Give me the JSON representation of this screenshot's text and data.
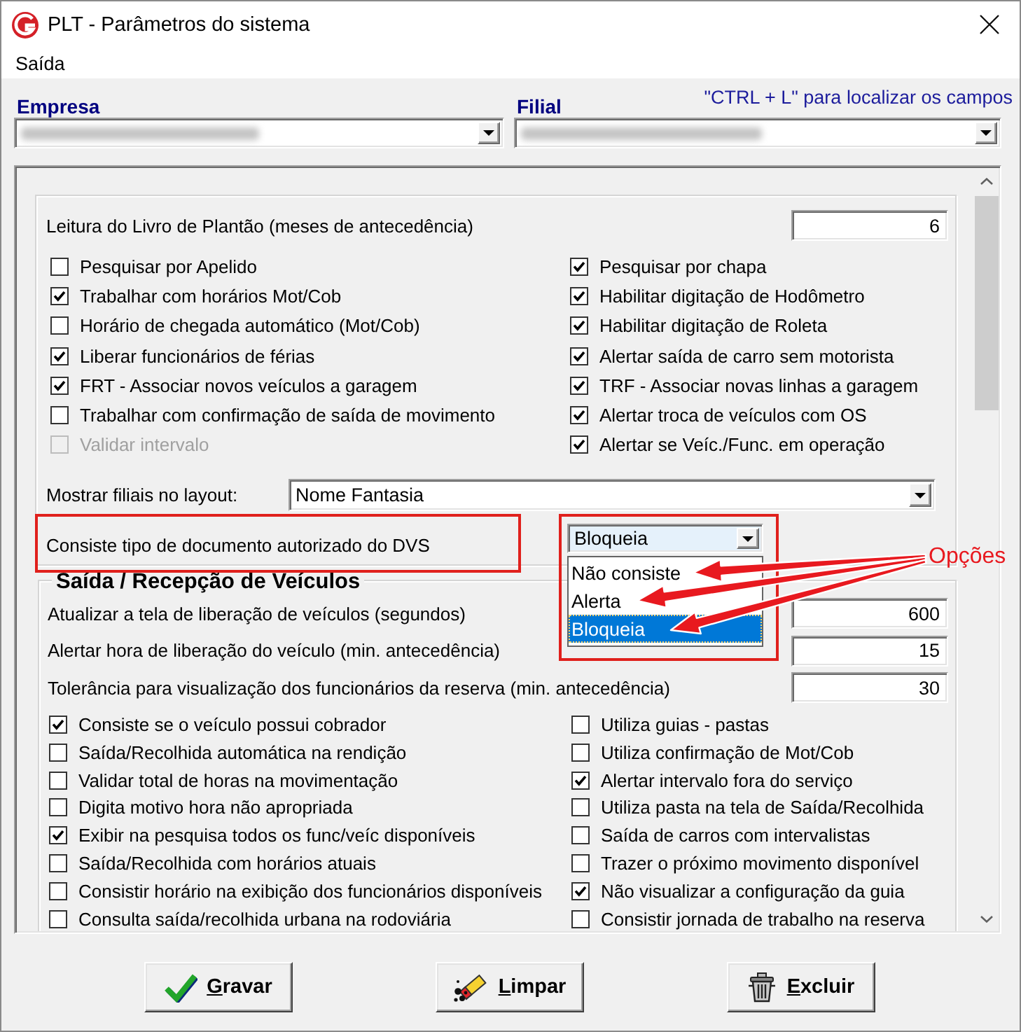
{
  "window": {
    "title": "PLT - Parâmetros do sistema"
  },
  "menu": [
    {
      "label": "Saída"
    }
  ],
  "company": {
    "empresa_label": "Empresa",
    "filial_label": "Filial",
    "hint": "\"CTRL + L\" para localizar os campos"
  },
  "general": {
    "months_field": {
      "label": "Leitura do Livro de Plantão (meses de antecedência)",
      "value": "6"
    },
    "left_options": [
      {
        "label": "Pesquisar por Apelido",
        "checked": false,
        "disabled": false
      },
      {
        "label": "Trabalhar com horários Mot/Cob",
        "checked": true,
        "disabled": false
      },
      {
        "label": "Horário de chegada automático (Mot/Cob)",
        "checked": false,
        "disabled": false
      },
      {
        "label": "Liberar funcionários de férias",
        "checked": true,
        "disabled": false
      },
      {
        "label": "FRT - Associar novos veículos a garagem",
        "checked": true,
        "disabled": false
      },
      {
        "label": "Trabalhar com confirmação de saída de movimento",
        "checked": false,
        "disabled": false
      },
      {
        "label": "Validar intervalo",
        "checked": false,
        "disabled": true
      }
    ],
    "right_options": [
      {
        "label": "Pesquisar por chapa",
        "checked": true,
        "disabled": false
      },
      {
        "label": "Habilitar digitação de Hodômetro",
        "checked": true,
        "disabled": false
      },
      {
        "label": "Habilitar digitação de Roleta",
        "checked": true,
        "disabled": false
      },
      {
        "label": "Alertar saída de carro sem motorista",
        "checked": true,
        "disabled": false
      },
      {
        "label": "TRF - Associar novas linhas a garagem",
        "checked": true,
        "disabled": false
      },
      {
        "label": "Alertar troca de veículos com OS",
        "checked": true,
        "disabled": false
      },
      {
        "label": "Alertar se Veíc./Func. em operação",
        "checked": true,
        "disabled": false
      }
    ],
    "layout_branches": {
      "label": "Mostrar filiais no layout:",
      "value": "Nome Fantasia"
    },
    "document_type": {
      "label": "Consiste tipo de documento autorizado do DVS",
      "value": "Bloqueia",
      "open": true,
      "options": [
        {
          "label": "Não consiste",
          "selected": false
        },
        {
          "label": "Alerta",
          "selected": false
        },
        {
          "label": "Bloqueia",
          "selected": true
        }
      ]
    }
  },
  "vehicles": {
    "title": "Saída / Recepção de Veículos",
    "fields": [
      {
        "label": "Atualizar a tela de liberação de veículos (segundos)",
        "value": "600"
      },
      {
        "label": "Alertar hora de liberação do veículo (min. antecedência)",
        "value": "15"
      },
      {
        "label": "Tolerância para visualização dos funcionários da reserva (min. antecedência)",
        "value": "30"
      }
    ],
    "left_options": [
      {
        "label": "Consiste se o veículo possui cobrador",
        "checked": true,
        "disabled": false
      },
      {
        "label": "Saída/Recolhida automática na rendição",
        "checked": false,
        "disabled": false
      },
      {
        "label": "Validar total de horas na movimentação",
        "checked": false,
        "disabled": false
      },
      {
        "label": "Digita motivo hora não apropriada",
        "checked": false,
        "disabled": false
      },
      {
        "label": "Exibir na pesquisa todos os func/veíc disponíveis",
        "checked": true,
        "disabled": false
      },
      {
        "label": "Saída/Recolhida com horários atuais",
        "checked": false,
        "disabled": false
      },
      {
        "label": "Consistir horário na exibição dos funcionários disponíveis",
        "checked": false,
        "disabled": false
      },
      {
        "label": "Consulta saída/recolhida urbana na rodoviária",
        "checked": false,
        "disabled": false
      }
    ],
    "right_options": [
      {
        "label": "Utiliza guias - pastas",
        "checked": false,
        "disabled": false
      },
      {
        "label": "Utiliza confirmação de Mot/Cob",
        "checked": false,
        "disabled": false
      },
      {
        "label": "Alertar intervalo fora do serviço",
        "checked": true,
        "disabled": false
      },
      {
        "label": "Utiliza pasta na tela de Saída/Recolhida",
        "checked": false,
        "disabled": false
      },
      {
        "label": "Saída de carros com intervalistas",
        "checked": false,
        "disabled": false
      },
      {
        "label": "Trazer o próximo movimento disponível",
        "checked": false,
        "disabled": false
      },
      {
        "label": "Não visualizar a configuração da guia",
        "checked": true,
        "disabled": false
      },
      {
        "label": "Consistir jornada de trabalho na reserva",
        "checked": false,
        "disabled": false
      }
    ]
  },
  "annotation": {
    "label": "Opções"
  },
  "buttons": [
    {
      "label": "Gravar",
      "kind": "save"
    },
    {
      "label": "Limpar",
      "kind": "clear"
    },
    {
      "label": "Excluir",
      "kind": "delete"
    }
  ]
}
